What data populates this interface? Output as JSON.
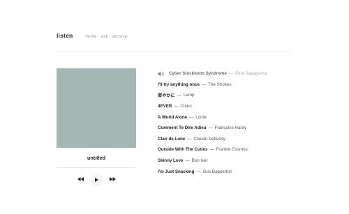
{
  "header": {
    "brand": "listen",
    "nav": [
      {
        "label": "home"
      },
      {
        "label": "ask"
      },
      {
        "label": "archive"
      }
    ]
  },
  "player": {
    "title": "untitled",
    "icons": {
      "prev": "rewind-icon",
      "play": "play-icon",
      "next": "fast-forward-icon"
    },
    "cover_color": "#a5b7b4"
  },
  "sep": "—",
  "playlist": [
    {
      "title": "Cyber Stockholm Syndrome",
      "artist": "Rina Sawayama",
      "current": true
    },
    {
      "title": "I'll try anything once",
      "artist": "The Strokes"
    },
    {
      "title": "密やかに",
      "artist": "Lamp"
    },
    {
      "title": "4EVER",
      "artist": "Clairo"
    },
    {
      "title": "A World Alone",
      "artist": "Lorde"
    },
    {
      "title": "Comment Te Dire Adieu",
      "artist": "Françoise Hardy"
    },
    {
      "title": "Clair de Lune",
      "artist": "Claude Debussy"
    },
    {
      "title": "Outside With The Cuties",
      "artist": "Frankie Cosmos"
    },
    {
      "title": "Skinny Love",
      "artist": "Bon Iver"
    },
    {
      "title": "I'm Just Snacking",
      "artist": "Gus Dapperton"
    }
  ]
}
